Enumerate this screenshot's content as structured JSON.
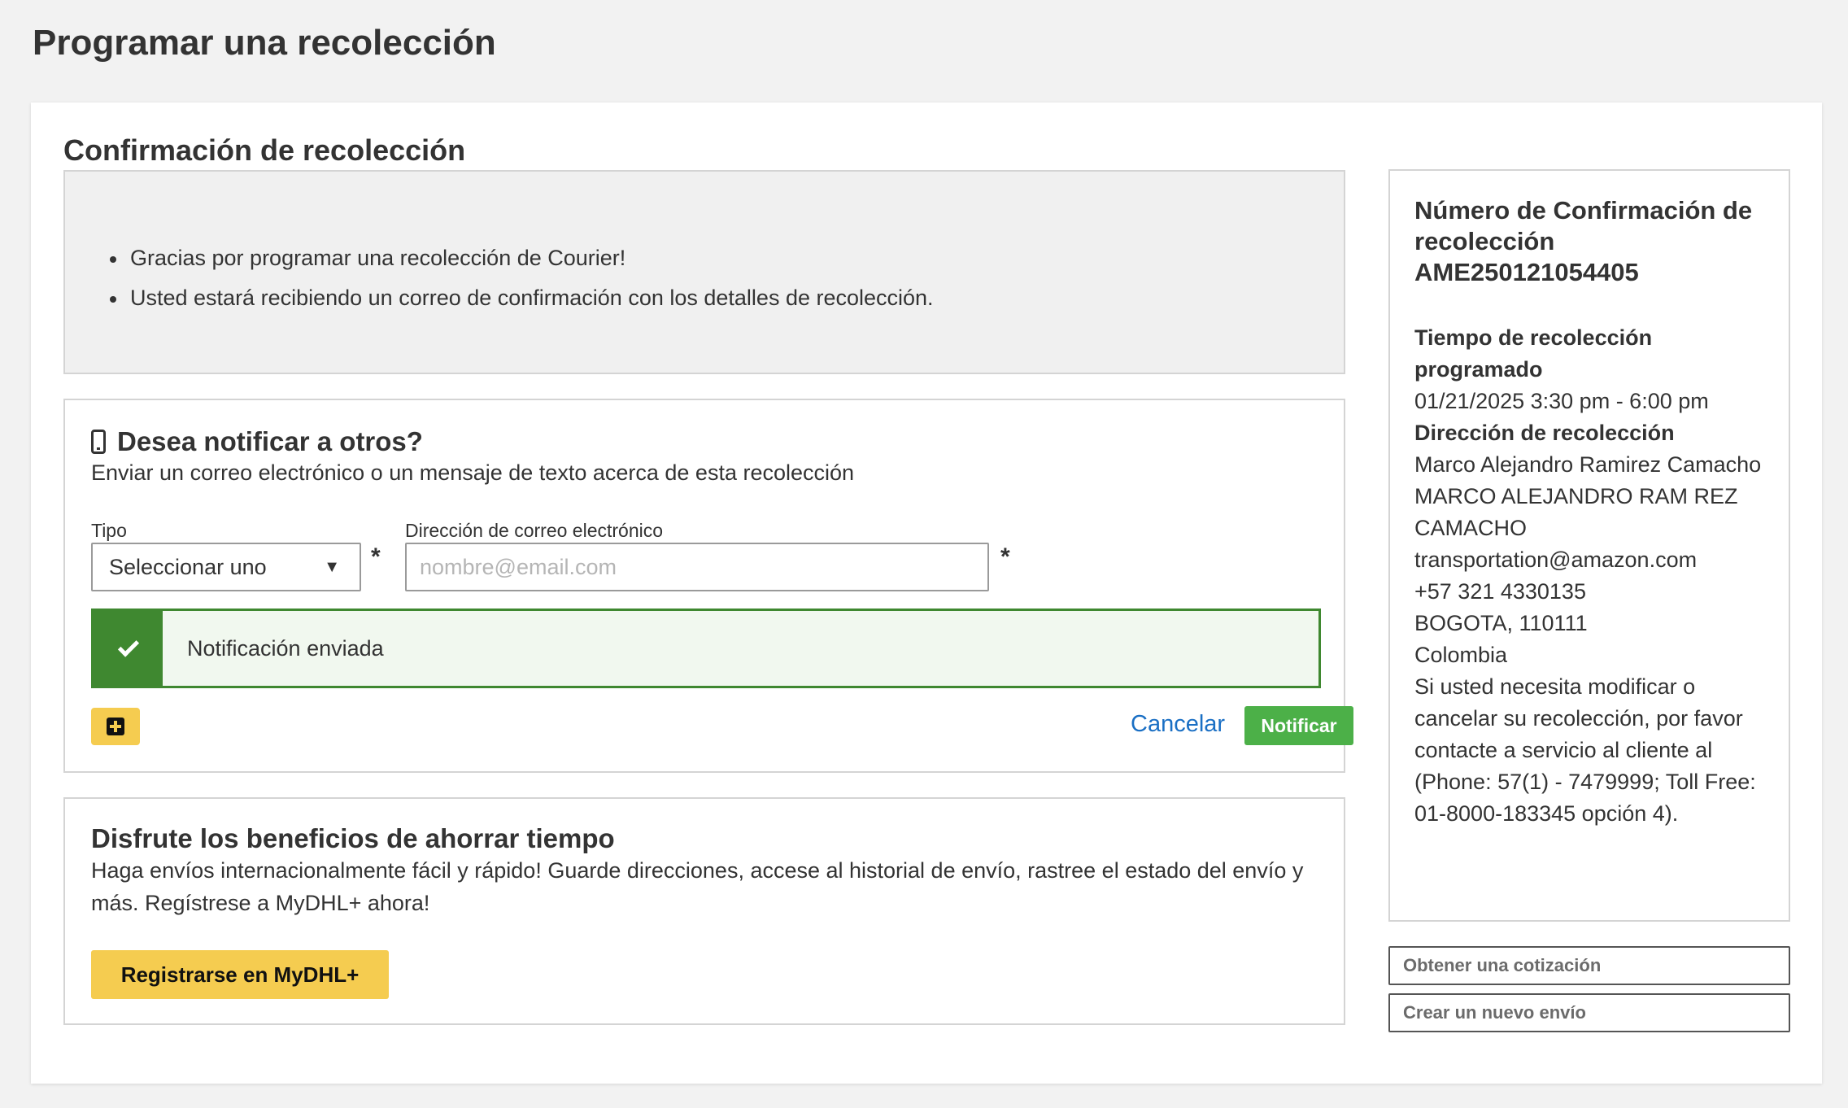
{
  "page_title": "Programar una recolección",
  "section_title": "Confirmación de recolección",
  "info_messages": [
    "Gracias por programar una recolección de Courier!",
    "Usted estará recibiendo un correo de confirmación con los detalles de recolección."
  ],
  "notify": {
    "icon": "mobile-phone-icon",
    "title": "Desea notificar a otros?",
    "subtitle": "Enviar un correo electrónico o un mensaje de texto acerca de esta recolección",
    "type_label": "Tipo",
    "type_value": "Seleccionar uno",
    "email_label": "Dirección de correo electrónico",
    "email_placeholder": "nombre@email.com",
    "required_mark": "*",
    "success_message": "Notificación enviada",
    "cancel_label": "Cancelar",
    "notify_label": "Notificar"
  },
  "promo": {
    "title": "Disfrute los beneficios de ahorrar tiempo",
    "text": "Haga envíos internacionalmente fácil y rápido! Guarde direcciones, accese al historial de envío, rastree el estado del envío y más. Regístrese a MyDHL+ ahora!",
    "button_label": "Registrarse en MyDHL+"
  },
  "sidebar": {
    "conf_title": "Número de Confirmación de recolección",
    "conf_number": "AME250121054405",
    "time_label": "Tiempo de recolección programado",
    "time_value": "01/21/2025 3:30 pm - 6:00 pm",
    "address_label": "Dirección de recolección",
    "address_lines": [
      "Marco Alejandro Ramirez Camacho",
      "MARCO ALEJANDRO RAM REZ CAMACHO",
      "transportation@amazon.com",
      "+57 321 4330135",
      "BOGOTA, 110111",
      "Colombia"
    ],
    "help_text": "Si usted necesita modificar o cancelar su recolección, por favor contacte a servicio al cliente al (Phone: 57(1) - 7479999; Toll Free: 01-8000-183345 opción 4).",
    "quote_button": "Obtener una cotización",
    "new_shipment_button": "Crear un nuevo envío"
  },
  "colors": {
    "accent_yellow": "#f5cc50",
    "success_green": "#3f8830",
    "notify_green": "#4cb048",
    "link_blue": "#1a6fc4"
  }
}
